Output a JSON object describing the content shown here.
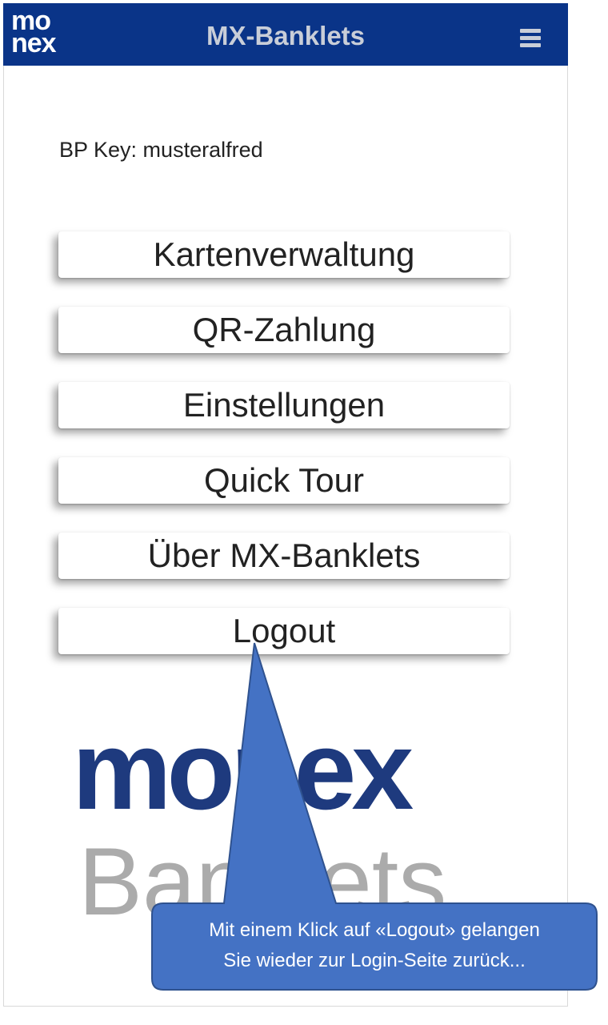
{
  "header": {
    "logo_line1": "mo",
    "logo_line2": "nex",
    "title": "MX-Banklets",
    "menu_icon": "hamburger-menu-icon"
  },
  "bp_key": "BP Key: musteralfred",
  "menu": [
    {
      "label": "Kartenverwaltung"
    },
    {
      "label": "QR-Zahlung"
    },
    {
      "label": "Einstellungen"
    },
    {
      "label": "Quick Tour"
    },
    {
      "label": "Über MX-Banklets"
    },
    {
      "label": "Logout"
    }
  ],
  "brand_logo": {
    "word1": "monex",
    "word2": "Banklets"
  },
  "callout": {
    "line1": "Mit einem Klick auf «Logout» gelangen",
    "line2": "Sie wieder zur Login-Seite zurück..."
  },
  "colors": {
    "header_bg": "#0a3488",
    "logo_blue": "#1e3a7e",
    "logo_gray": "#ababab",
    "callout_fill": "#4472c4",
    "callout_border": "#2f528f"
  }
}
